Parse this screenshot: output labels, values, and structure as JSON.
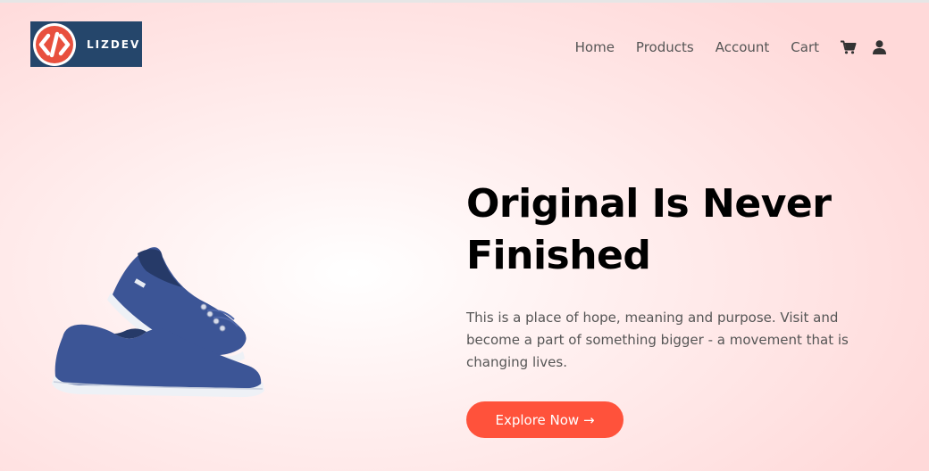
{
  "brand": {
    "logo_text": "LIZDEV",
    "logo_icon": "code-brackets-icon",
    "colors": {
      "logo_bg": "#25466b",
      "logo_accent": "#e8503e"
    }
  },
  "nav": {
    "items": [
      {
        "label": "Home"
      },
      {
        "label": "Products"
      },
      {
        "label": "Account"
      },
      {
        "label": "Cart"
      }
    ],
    "icons": [
      "cart-icon",
      "user-icon"
    ]
  },
  "hero": {
    "title_line1": "Original Is Never",
    "title_line2": "Finished",
    "description": "This is a place of hope, meaning and purpose. Visit and become a part of something bigger - a movement that is changing lives.",
    "cta_label": "Explore Now →",
    "image": "blue-sneakers-image",
    "colors": {
      "cta": "#ff523b",
      "title": "#000000",
      "text": "#555555"
    }
  }
}
